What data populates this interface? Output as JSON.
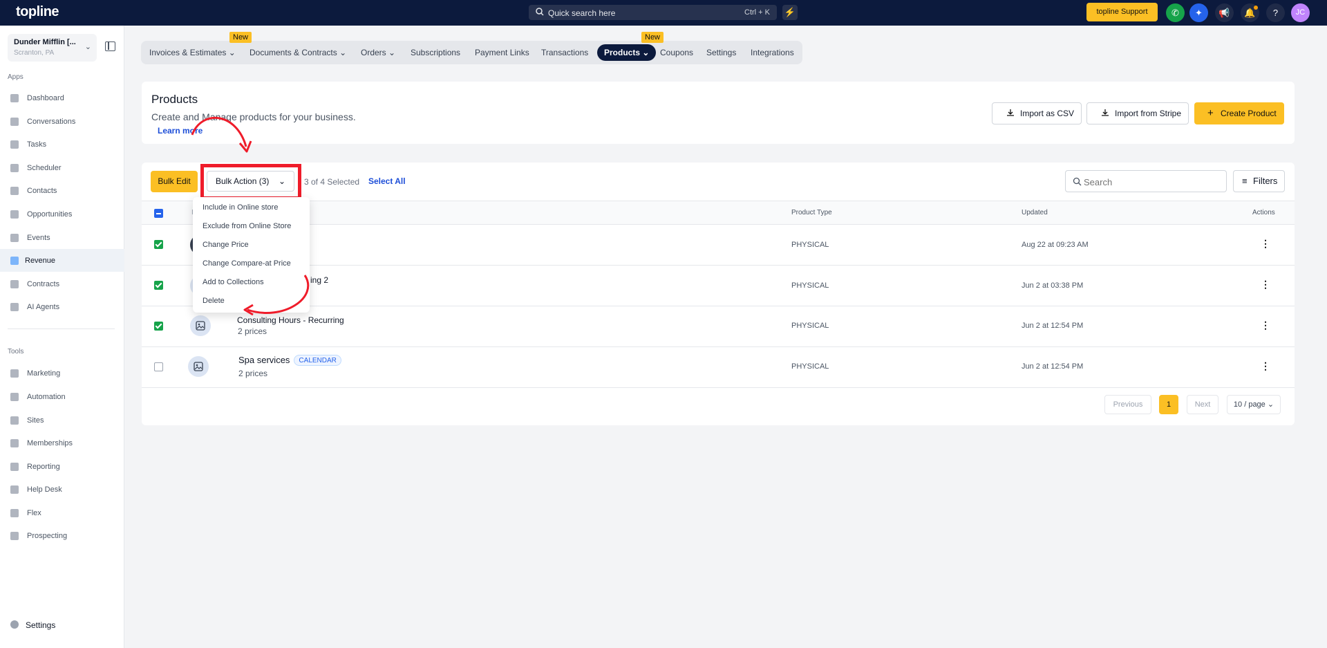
{
  "topbar": {
    "logo": "topline",
    "search_placeholder": "Quick search here",
    "search_shortcut": "Ctrl + K",
    "support_label": "topline Support",
    "avatar_initials": "JC"
  },
  "sidebar": {
    "location_name": "Dunder Mifflin [...",
    "location_city": "Scranton, PA",
    "apps_heading": "Apps",
    "apps": [
      {
        "label": "Dashboard"
      },
      {
        "label": "Conversations"
      },
      {
        "label": "Tasks"
      },
      {
        "label": "Scheduler"
      },
      {
        "label": "Contacts"
      },
      {
        "label": "Opportunities"
      },
      {
        "label": "Events"
      },
      {
        "label": "Revenue",
        "active": true
      },
      {
        "label": "Contracts"
      },
      {
        "label": "AI Agents"
      }
    ],
    "tools_heading": "Tools",
    "tools": [
      {
        "label": "Marketing"
      },
      {
        "label": "Automation"
      },
      {
        "label": "Sites"
      },
      {
        "label": "Memberships"
      },
      {
        "label": "Reporting"
      },
      {
        "label": "Help Desk"
      },
      {
        "label": "Flex"
      },
      {
        "label": "Prospecting"
      }
    ],
    "settings_label": "Settings"
  },
  "tabs": {
    "items": [
      {
        "label": "Invoices & Estimates"
      },
      {
        "label": "Documents & Contracts"
      },
      {
        "label": "Orders"
      },
      {
        "label": "Subscriptions"
      },
      {
        "label": "Payment Links"
      },
      {
        "label": "Transactions"
      },
      {
        "label": "Products"
      },
      {
        "label": "Coupons"
      },
      {
        "label": "Settings"
      },
      {
        "label": "Integrations"
      }
    ],
    "new_badge": "New"
  },
  "header": {
    "title": "Products",
    "subtitle": "Create and Manage products for your business.",
    "learn_more": "Learn more",
    "import_csv": "Import as CSV",
    "import_stripe": "Import from Stripe",
    "create_product": "Create Product"
  },
  "toolbar": {
    "bulk_edit": "Bulk Edit",
    "bulk_action": "Bulk Action (3)",
    "selected_count": "3 of 4 Selected",
    "select_all": "Select All",
    "search_placeholder": "Search",
    "filters": "Filters"
  },
  "bulk_menu": [
    "Include in Online store",
    "Exclude from Online Store",
    "Change Price",
    "Change Compare-at Price",
    "Add to Collections",
    "Delete"
  ],
  "table": {
    "columns": {
      "product_type": "Product Type",
      "updated": "Updated",
      "actions": "Actions"
    },
    "rows": [
      {
        "name": "",
        "prices": "",
        "type": "PHYSICAL",
        "updated": "Aug 22 at 09:23 AM",
        "checked": true
      },
      {
        "name": "ing 2",
        "prices": "",
        "type": "PHYSICAL",
        "updated": "Jun 2 at 03:38 PM",
        "checked": true
      },
      {
        "name": "Consulting Hours - Recurring",
        "prices": "2 prices",
        "type": "PHYSICAL",
        "updated": "Jun 2 at 12:54 PM",
        "checked": true
      },
      {
        "name": "Spa services",
        "badge": "CALENDAR",
        "prices": "2 prices",
        "type": "PHYSICAL",
        "updated": "Jun 2 at 12:54 PM",
        "checked": false
      }
    ]
  },
  "pagination": {
    "previous": "Previous",
    "current": "1",
    "next": "Next",
    "page_size": "10 / page"
  },
  "colors": {
    "topbar": "#0c1a3d",
    "accent": "#fbbf24",
    "highlight": "#ef1c2a",
    "link": "#1d4ed8"
  }
}
